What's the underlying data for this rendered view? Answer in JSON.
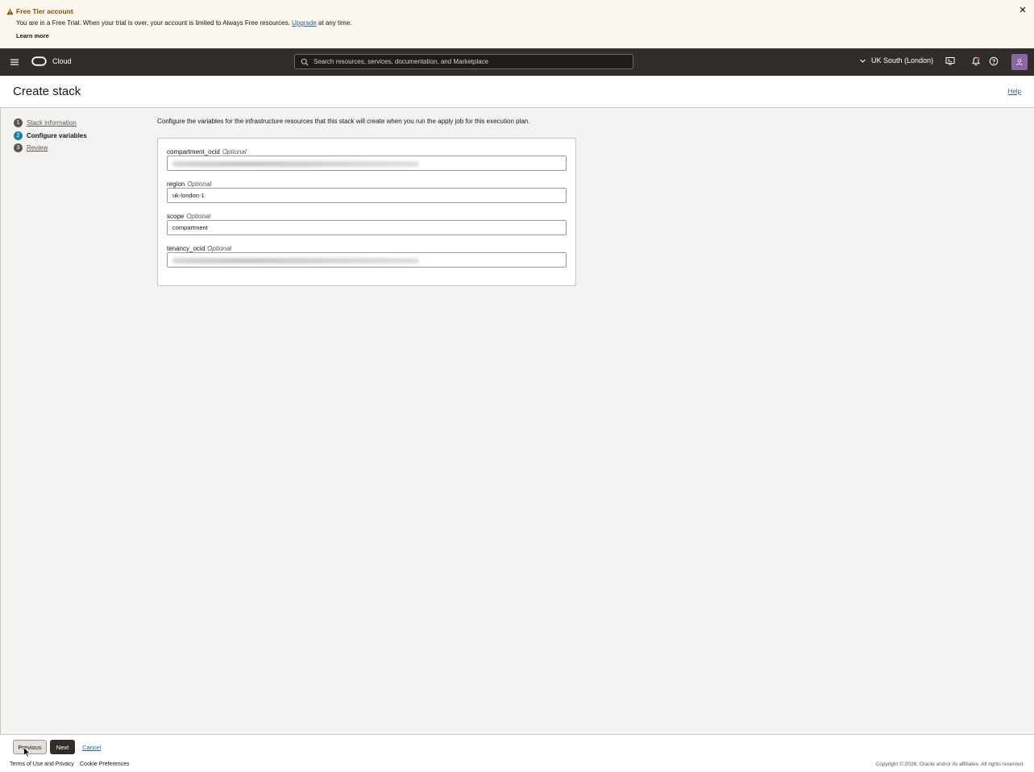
{
  "banner": {
    "title": "Free Tier account",
    "message_before": "You are in a Free Trial. When your trial is over, your account is limited to Always Free resources.",
    "upgrade_link": "Upgrade",
    "message_after": "at any time.",
    "learn_more": "Learn more"
  },
  "topbar": {
    "brand": "Cloud",
    "search_placeholder": "Search resources, services, documentation, and Marketplace",
    "region": "UK South (London)",
    "icons": [
      "menu-icon",
      "oracle-logo-icon",
      "search-icon",
      "chevron-down-icon",
      "cloud-shell-icon",
      "bell-icon",
      "help-icon",
      "user-icon"
    ]
  },
  "page": {
    "title": "Create stack",
    "help": "Help"
  },
  "steps": [
    {
      "num": "1",
      "label": "Stack information",
      "state": "completed"
    },
    {
      "num": "2",
      "label": "Configure variables",
      "state": "active"
    },
    {
      "num": "3",
      "label": "Review",
      "state": "pending"
    }
  ],
  "main": {
    "description": "Configure the variables for the infrastructure resources that this stack will create when you run the apply job for this execution plan.",
    "fields": [
      {
        "name": "compartment_ocid",
        "optional": "Optional",
        "value": ""
      },
      {
        "name": "region",
        "optional": "Optional",
        "value": "uk-london-1"
      },
      {
        "name": "scope",
        "optional": "Optional",
        "value": "compartment"
      },
      {
        "name": "tenancy_ocid",
        "optional": "Optional",
        "value": ""
      }
    ]
  },
  "actions": {
    "previous": "Previous",
    "next": "Next",
    "cancel": "Cancel"
  },
  "footer": {
    "terms": "Terms of Use and Privacy",
    "cookies": "Cookie Preferences",
    "copyright": "Copyright © 2026, Oracle and/or its affiliates. All rights reserved."
  },
  "colors": {
    "topbar": "#312d2a",
    "banner": "#fcf8f0",
    "active_step": "#227e9e",
    "link": "#2a6496",
    "avatar": "#8a67a0"
  }
}
